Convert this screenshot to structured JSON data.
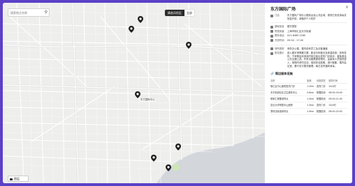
{
  "search": {
    "placeholder": "搜索地点名称",
    "icon": "search-icon"
  },
  "view_toggle": {
    "active": "精准风险区",
    "inactive": "全部"
  },
  "layer_button": {
    "label": "图层"
  },
  "markers": [
    {
      "label": ""
    },
    {
      "label": ""
    },
    {
      "label": ""
    },
    {
      "label": "东方国际中心"
    },
    {
      "label": ""
    },
    {
      "label": ""
    },
    {
      "label": ""
    }
  ],
  "panel": {
    "title": "东方国际广场",
    "close_icon": "close-icon",
    "details": [
      {
        "label": "门店",
        "value": "东方国际广场办公楼前台及公共区域，现场已完成消毒并恢复开放，请做好个人防护"
      },
      {
        "label": "基础信息",
        "value": "楼宇类型"
      },
      {
        "label": "所属街道",
        "value": "上海市徐汇区天平街道"
      },
      {
        "label": "联系电话",
        "value": "021-6469 2260"
      },
      {
        "label": "开放时间",
        "value": "09:00 - 17:00"
      }
    ],
    "extra": [
      {
        "label": "场所类型",
        "value": "商务办公楼，楼内设有员工及访客通道"
      },
      {
        "label": "防控提示",
        "value": "进入楼宇请佩戴口罩，配合扫码登记及体温检测；如有发热、干咳等症状请及时前往就近发热门诊就诊，避免乘坐公共交通工具。外来访客需提前预约，由接待人员陪同进入，电梯内请勿交谈，保持安全距离，减少聚集。楼内会议室、餐厅实行限流管理，每日定时通风消毒。"
      }
    ],
    "table_title": "周边服务设施",
    "table_headers": [
      "名称",
      "距离",
      "设施类型",
      "服务时间"
    ],
    "table_rows": [
      [
        "徐汇区中心医院发热门诊",
        "1.2km",
        "发热门诊",
        "24小时"
      ],
      [
        "天平街道社区卫生服务中心",
        "0.8km",
        "核酸检测",
        "08:00-16:00"
      ],
      [
        "徐家汇核酸采样点",
        "1.5km",
        "核酸检测",
        "09:00-21:00"
      ],
      [
        "复旦大学附属中山医院",
        "2.3km",
        "发热门诊",
        "24小时"
      ],
      [
        "漕河泾街道采样点",
        "2.9km",
        "核酸检测",
        "08:00-20:00"
      ]
    ]
  }
}
